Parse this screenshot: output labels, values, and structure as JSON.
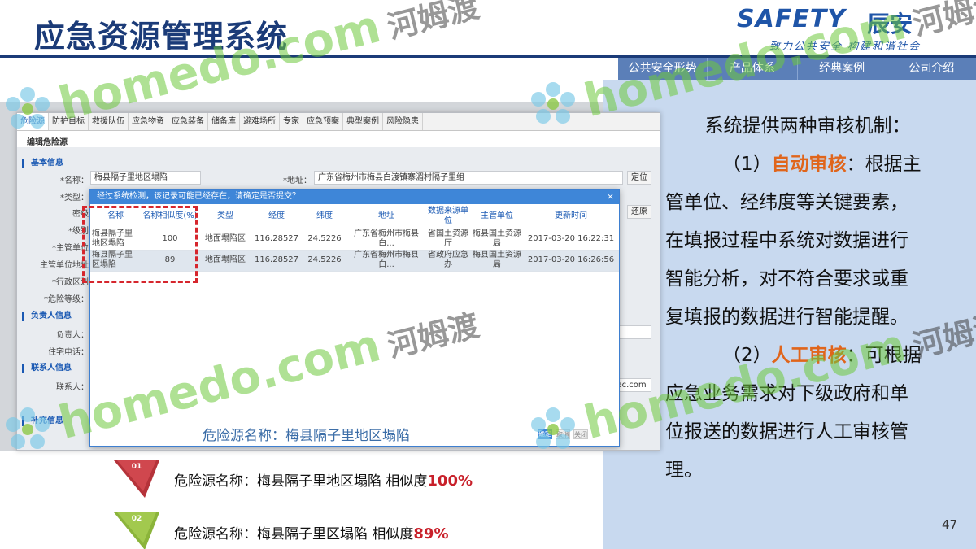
{
  "slide": {
    "title": "应急资源管理系统",
    "page_number": "47"
  },
  "logo": {
    "en": "SAFETY",
    "cn": "辰安",
    "slogan": "致力公共安全 构建和谐社会"
  },
  "topnav": [
    "公共安全形势",
    "产品体系",
    "经典案例",
    "公司介绍"
  ],
  "app": {
    "tabs": [
      "危险源",
      "防护目标",
      "救援队伍",
      "应急物资",
      "应急装备",
      "储备库",
      "避难场所",
      "专家",
      "应急预案",
      "典型案例",
      "风险隐患"
    ],
    "subtitle": "编辑危险源",
    "sections": {
      "basic": "基本信息",
      "person": "负责人信息",
      "contact": "联系人信息",
      "extra": "补充信息"
    },
    "labels": {
      "name": "*名称：",
      "address": "*地址：",
      "type": "*类型：",
      "level_a": "密级",
      "level_b": "*级别",
      "unit": "*主管单位",
      "unit_addr": "主管单位地址",
      "region": "*行政区划",
      "danger": "*危险等级：",
      "person_name": "负责人：",
      "home_phone": "住宅电话：",
      "contact_name": "联系人："
    },
    "fields": {
      "name": "梅县隔子里地区塌陷",
      "address": "广东省梅州市梅县白渡镇寨湄村隔子里组",
      "email_fragment": "opec.com"
    },
    "buttons": {
      "locate": "定位",
      "restore": "还原"
    }
  },
  "modal": {
    "title": "经过系统检测，该记录可能已经存在，请确定是否提交？",
    "close": "×",
    "columns": [
      "名称",
      "名称相似度(%)",
      "类型",
      "经度",
      "纬度",
      "地址",
      "数据来源单位",
      "主管单位",
      "更新时间"
    ],
    "rows": [
      [
        "梅县隔子里地区塌陷",
        "100",
        "地面塌陷区",
        "116.28527",
        "24.5226",
        "广东省梅州市梅县白...",
        "省国土资源厅",
        "梅县国土资源局",
        "2017-03-20 16:22:31"
      ],
      [
        "梅县隔子里区塌陷",
        "89",
        "地面塌陷区",
        "116.28527",
        "24.5226",
        "广东省梅州市梅县白...",
        "省政府应急办",
        "梅县国土资源局",
        "2017-03-20 16:26:56"
      ]
    ],
    "caption": "危险源名称：梅县隔子里地区塌陷",
    "btn_ok": "确定",
    "btn_cancel": "取消",
    "btn_third": "关闭"
  },
  "bottom_list": [
    {
      "num": "01",
      "text": "危险源名称：梅县隔子里地区塌陷   相似度",
      "pct": "100%"
    },
    {
      "num": "02",
      "text": "危险源名称：梅县隔子里区塌陷   相似度",
      "pct": "89%"
    }
  ],
  "right_text": {
    "intro": "系统提供两种审核机制：",
    "auto_prefix": "（1）",
    "auto_label": "自动审核",
    "auto_text_1": "：根据主",
    "auto_text_2": "管单位、经纬度等关键要素，",
    "auto_text_3": "在填报过程中系统对数据进行",
    "auto_text_4": "智能分析，对不符合要求或重",
    "auto_text_5": "复填报的数据进行智能提醒。",
    "manual_prefix": "（2）",
    "manual_label": "人工审核",
    "manual_text_1": "：可根据",
    "manual_text_2": "应急业务需求对下级政府和单",
    "manual_text_3": "位报送的数据进行人工审核管",
    "manual_text_4": "理。"
  },
  "watermark": {
    "latin": "homedo.com",
    "cn": "河姆渡"
  },
  "colors": {
    "title_blue": "#1b3b78",
    "nav_blue": "#5b7fb8",
    "panel_blue": "#c8d9ef",
    "highlight_orange": "#e0651b",
    "percent_red": "#c8202a",
    "ribbon_red": "#b5333a",
    "ribbon_green": "#8bb43a",
    "dash_red": "#d6262d"
  }
}
